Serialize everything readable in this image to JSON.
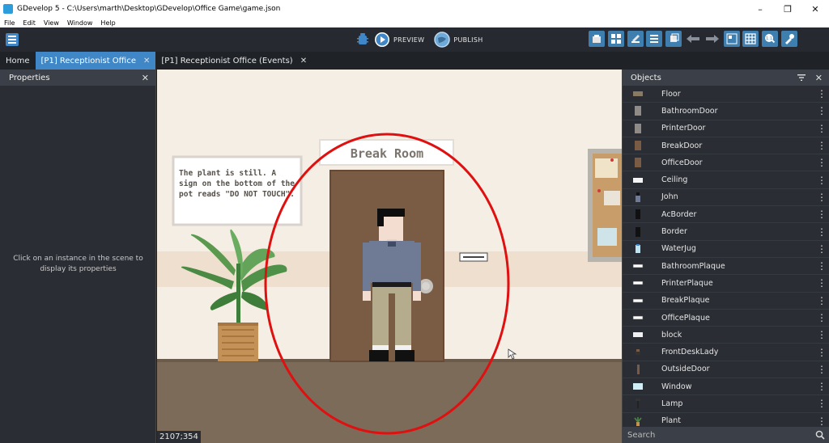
{
  "window": {
    "title": "GDevelop 5 - C:\\Users\\marth\\Desktop\\GDevelop\\Office Game\\game.json",
    "minimize": "–",
    "maximize": "❐",
    "close": "✕"
  },
  "menu": [
    "File",
    "Edit",
    "View",
    "Window",
    "Help"
  ],
  "toolbar": {
    "preview_label": "PREVIEW",
    "publish_label": "PUBLISH"
  },
  "tabs": [
    {
      "label": "Home",
      "active": false,
      "closable": false
    },
    {
      "label": "[P1] Receptionist Office",
      "active": true,
      "closable": true
    },
    {
      "label": "[P1] Receptionist Office (Events)",
      "active": false,
      "closable": true
    }
  ],
  "properties": {
    "title": "Properties",
    "empty_message": "Click on an instance in the scene to display its properties"
  },
  "scene": {
    "sign_text": "Break Room",
    "note_text": "The plant is still. A sign on the bottom of the pot reads \"DO NOT TOUCH\".",
    "cursor_coords": "2107;354",
    "colors": {
      "wall": "#f5eee5",
      "floor": "#7b6b58",
      "door": "#7a5c44",
      "highlight_circle": "#e01010"
    }
  },
  "objects": {
    "title": "Objects",
    "search_placeholder": "Search",
    "items": [
      {
        "name": "Floor",
        "thumb": "floor"
      },
      {
        "name": "BathroomDoor",
        "thumb": "door-gray"
      },
      {
        "name": "PrinterDoor",
        "thumb": "door-gray"
      },
      {
        "name": "BreakDoor",
        "thumb": "door-brown"
      },
      {
        "name": "OfficeDoor",
        "thumb": "door-brown"
      },
      {
        "name": "Ceiling",
        "thumb": "ceiling"
      },
      {
        "name": "John",
        "thumb": "person"
      },
      {
        "name": "AcBorder",
        "thumb": "border"
      },
      {
        "name": "Border",
        "thumb": "border"
      },
      {
        "name": "WaterJug",
        "thumb": "jug"
      },
      {
        "name": "BathroomPlaque",
        "thumb": "plaque"
      },
      {
        "name": "PrinterPlaque",
        "thumb": "plaque"
      },
      {
        "name": "BreakPlaque",
        "thumb": "plaque"
      },
      {
        "name": "OfficePlaque",
        "thumb": "plaque"
      },
      {
        "name": "block",
        "thumb": "block"
      },
      {
        "name": "FrontDeskLady",
        "thumb": "lady"
      },
      {
        "name": "OutsideDoor",
        "thumb": "door-thin"
      },
      {
        "name": "Window",
        "thumb": "window"
      },
      {
        "name": "Lamp",
        "thumb": "lamp"
      },
      {
        "name": "Plant",
        "thumb": "plant"
      }
    ]
  }
}
